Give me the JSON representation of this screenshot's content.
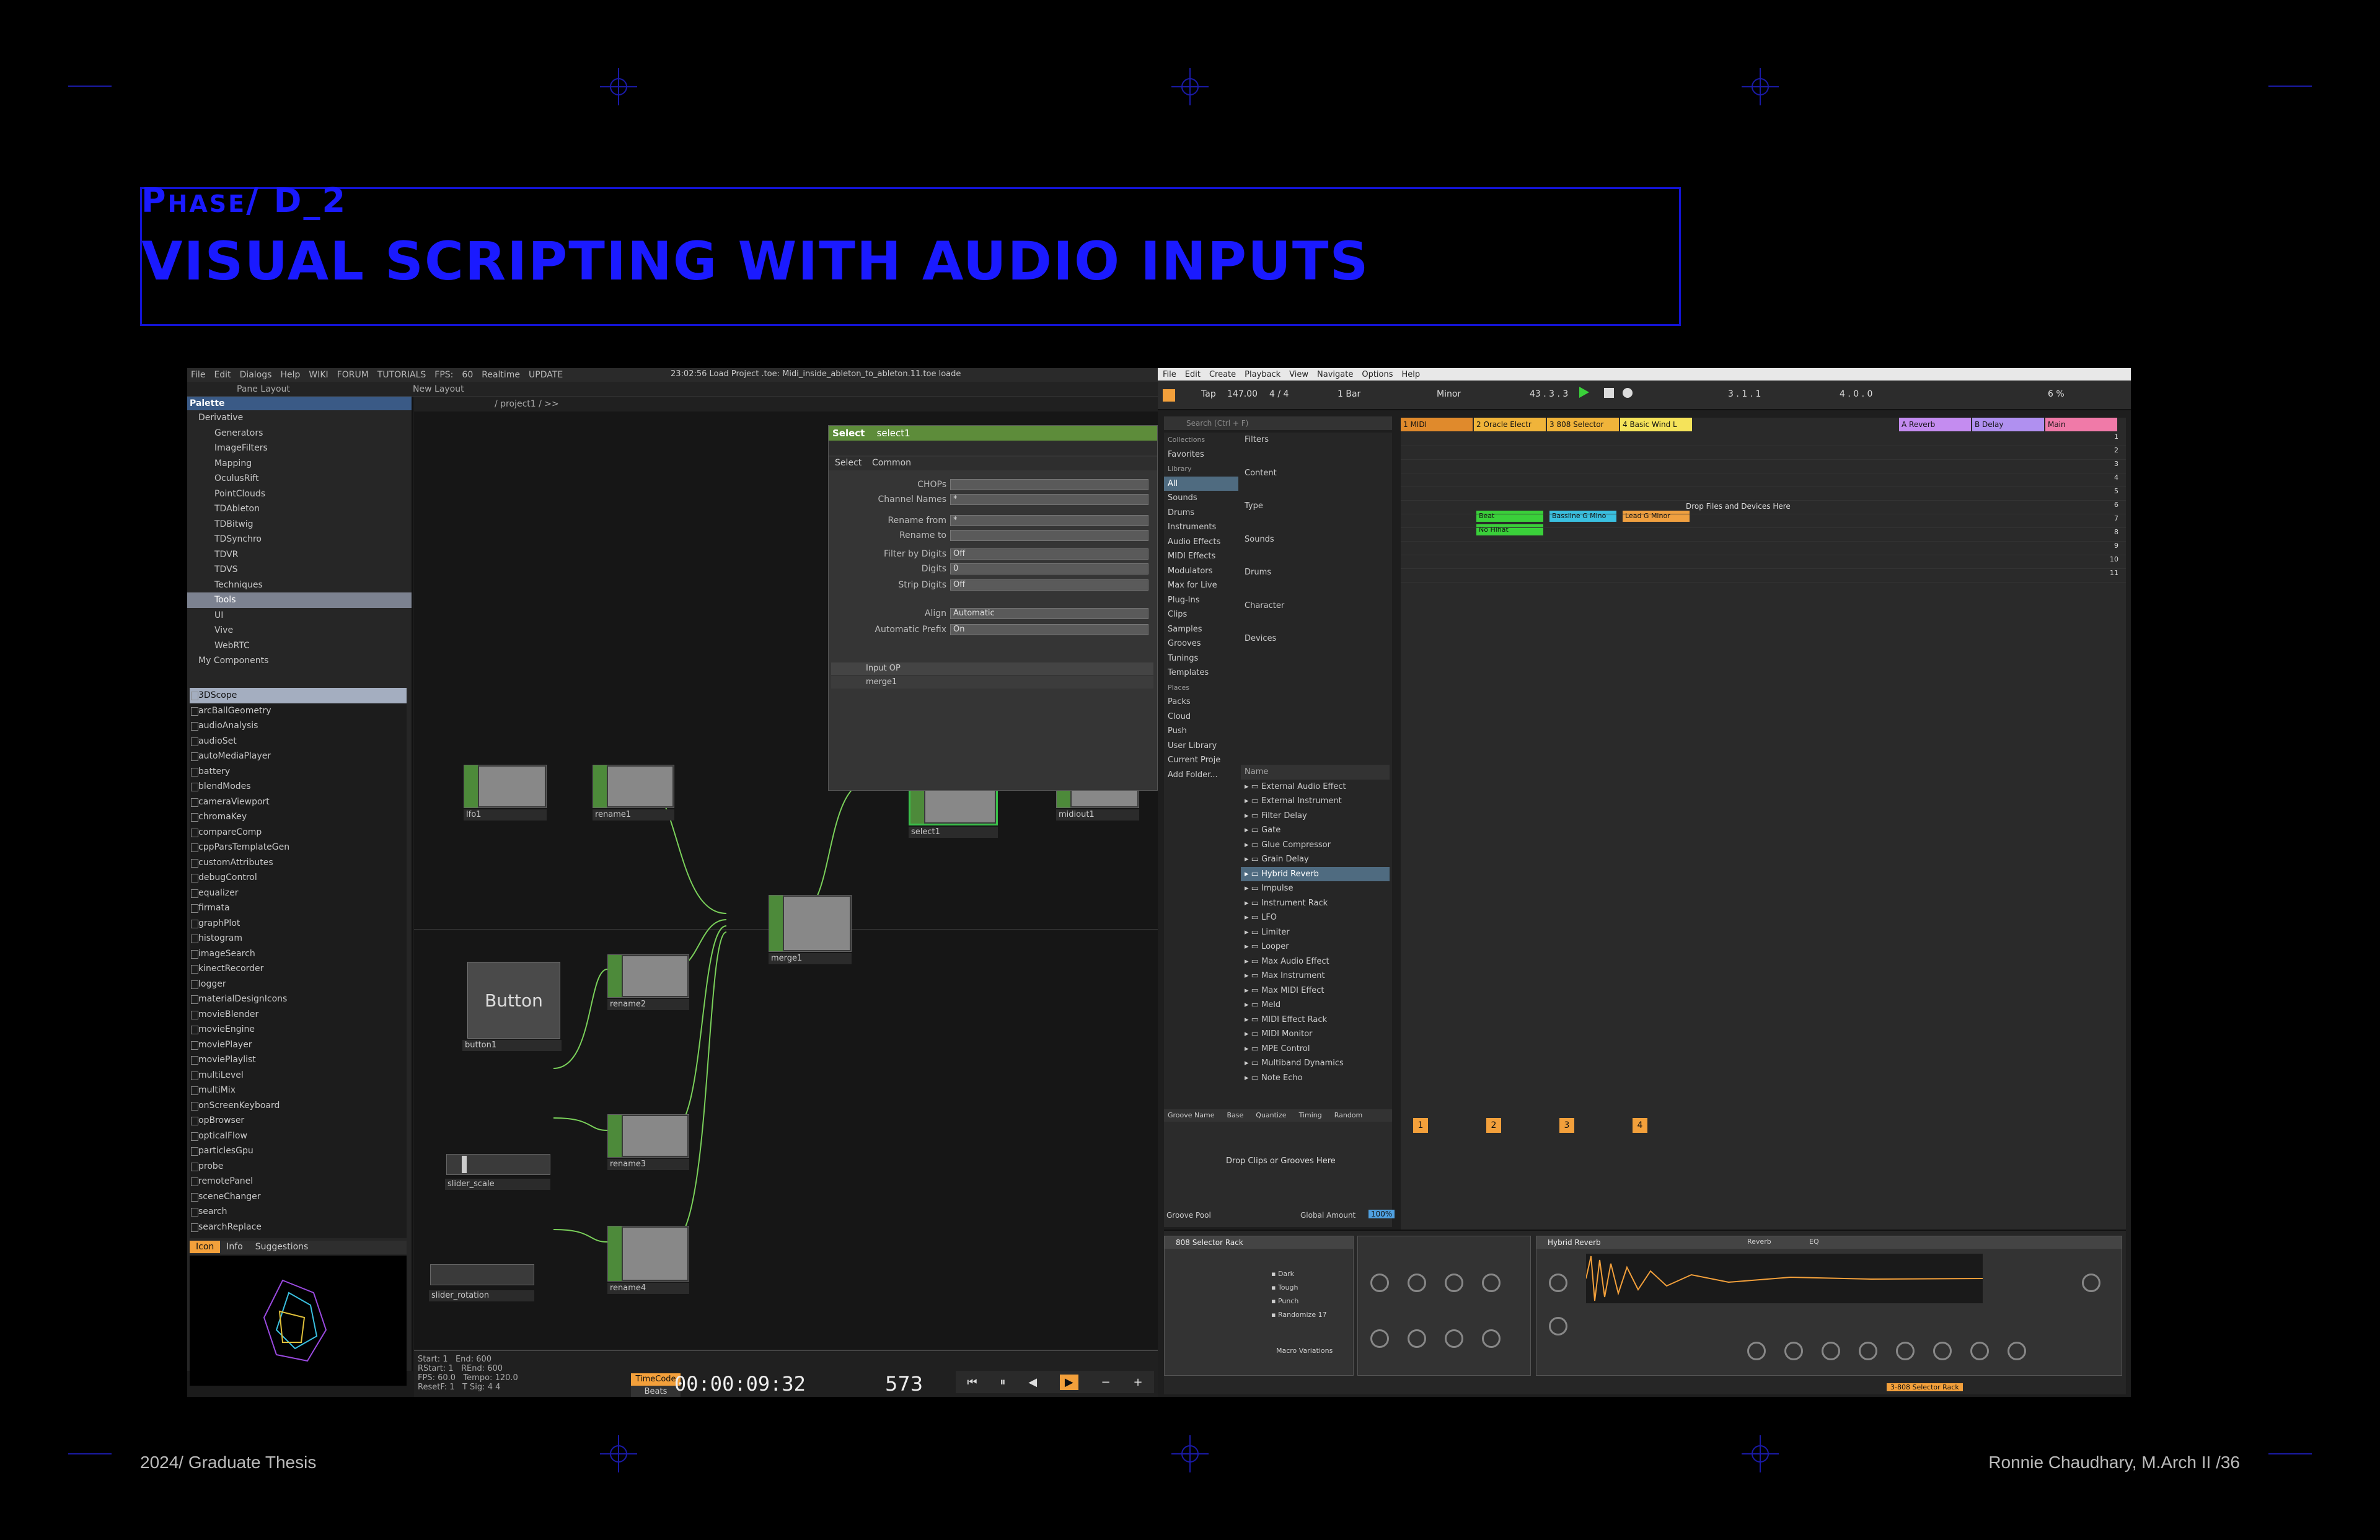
{
  "slide": {
    "phase": "Phase/ D_2",
    "title": "VISUAL SCRIPTING WITH AUDIO INPUTS",
    "footer_left": "2024/ Graduate Thesis",
    "footer_right": "Ronnie Chaudhary, M.Arch II /36",
    "accent_color": "#1a1aff"
  },
  "touchdesigner": {
    "menu": [
      "File",
      "Edit",
      "Dialogs",
      "Help",
      "WIKI",
      "FORUM",
      "TUTORIALS",
      "FPS:",
      "Realtime",
      "UPDATE"
    ],
    "fps_value": "60",
    "status_text": "23:02:56 Load Project .toe: Midi_inside_ableton_to_ableton.11.toe loade",
    "pane_layout": "Pane Layout",
    "new_layout": "New Layout",
    "path": "/ project1 / >>",
    "palette_title": "Palette",
    "tree": [
      "Derivative",
      "Generators",
      "ImageFilters",
      "Mapping",
      "OculusRift",
      "PointClouds",
      "TDAbleton",
      "TDBitwig",
      "TDSynchro",
      "TDVR",
      "TDVS",
      "Techniques",
      "Tools",
      "UI",
      "Vive",
      "WebRTC",
      "My Components"
    ],
    "oplist": [
      "3DScope",
      "arcBallGeometry",
      "audioAnalysis",
      "audioSet",
      "autoMediaPlayer",
      "battery",
      "blendModes",
      "cameraViewport",
      "chromaKey",
      "compareComp",
      "cppParsTemplateGen",
      "customAttributes",
      "debugControl",
      "equalizer",
      "firmata",
      "graphPlot",
      "histogram",
      "imageSearch",
      "kinectRecorder",
      "logger",
      "materialDesignIcons",
      "movieBlender",
      "movieEngine",
      "moviePlayer",
      "moviePlaylist",
      "multiLevel",
      "multiMix",
      "onScreenKeyboard",
      "opBrowser",
      "opticalFlow",
      "particlesGpu",
      "probe",
      "remotePanel",
      "sceneChanger",
      "search",
      "searchReplace"
    ],
    "palette_tabs": [
      "Icon",
      "Info",
      "Suggestions"
    ],
    "nodes": [
      "lfo1",
      "rename1",
      "merge1",
      "select1",
      "midiout1",
      "button1",
      "rename2",
      "slider_scale",
      "rename3",
      "slider_rotation",
      "rename4"
    ],
    "button_label": "Button",
    "param": {
      "type": "Select",
      "name": "select1",
      "tabs": [
        "Select",
        "Common"
      ],
      "rows": [
        {
          "label": "CHOPs",
          "value": ""
        },
        {
          "label": "Channel Names",
          "value": "*"
        },
        {
          "label": "Rename from",
          "value": "*"
        },
        {
          "label": "Rename to",
          "value": ""
        },
        {
          "label": "Filter by Digits",
          "value": "Off"
        },
        {
          "label": "Digits",
          "value": "0"
        },
        {
          "label": "Strip Digits",
          "value": "Off"
        },
        {
          "label": "Align",
          "value": "Automatic"
        },
        {
          "label": "Automatic Prefix",
          "value": "On"
        }
      ],
      "input_op_header": "Input OP",
      "input_op_value": "merge1"
    },
    "time": {
      "start": "1",
      "end": "600",
      "rstart": "1",
      "rend": "600",
      "fps": "60.0",
      "tempo": "120.0",
      "resetf": "1",
      "tsig": "4   4",
      "timecode_label": "TimeCode",
      "beats_label": "Beats",
      "timecode": "00:00:09:32",
      "frame": "573"
    }
  },
  "ableton": {
    "menu": [
      "File",
      "Edit",
      "Create",
      "Playback",
      "View",
      "Navigate",
      "Options",
      "Help"
    ],
    "tempo": "147.00",
    "signature": "4 / 4",
    "bar": "1 Bar",
    "scale": "Minor",
    "position": "43 . 3 . 3",
    "loop_start": "3 . 1 . 1",
    "loop_len": "4 . 0 . 0",
    "cpu": "6 %",
    "search_placeholder": "Search (Ctrl + F)",
    "browser": [
      "Collections",
      "Favorites",
      "Library",
      "All",
      "Sounds",
      "Drums",
      "Instruments",
      "Audio Effects",
      "MIDI Effects",
      "Modulators",
      "Max for Live",
      "Plug-Ins",
      "Clips",
      "Samples",
      "Grooves",
      "Tunings",
      "Templates",
      "Places",
      "Packs",
      "Cloud",
      "Push",
      "User Library",
      "Current Proje",
      "Add Folder..."
    ],
    "filters": [
      "Filters",
      "Content",
      "Type",
      "Sounds",
      "Drums",
      "Character",
      "Devices"
    ],
    "results": [
      "External Audio Effect",
      "External Instrument",
      "Filter Delay",
      "Gate",
      "Glue Compressor",
      "Grain Delay",
      "Hybrid Reverb",
      "Impulse",
      "Instrument Rack",
      "LFO",
      "Limiter",
      "Looper",
      "Max Audio Effect",
      "Max Instrument",
      "Max MIDI Effect",
      "Meld",
      "MIDI Effect Rack",
      "MIDI Monitor",
      "MPE Control",
      "Multiband Dynamics",
      "Note Echo"
    ],
    "results_header": "Name",
    "tracks": [
      {
        "name": "1 MIDI",
        "color": "#e08a2c"
      },
      {
        "name": "2 Oracle Electr",
        "color": "#f0b43a"
      },
      {
        "name": "3 808 Selector",
        "color": "#f0b43a"
      },
      {
        "name": "4 Basic Wind L",
        "color": "#f5e35a"
      }
    ],
    "returns": [
      {
        "name": "A Reverb",
        "color": "#c48cf0"
      },
      {
        "name": "B Delay",
        "color": "#b090f0"
      },
      {
        "name": "Main",
        "color": "#f07aa8"
      }
    ],
    "clips": [
      {
        "label": "Beat",
        "color": "#3ad03a"
      },
      {
        "label": "No Hihat",
        "color": "#3ad03a"
      },
      {
        "label": "Bassline G Mino",
        "color": "#3ac0e0"
      },
      {
        "label": "Lead G Minor",
        "color": "#f0a040"
      }
    ],
    "scenes": [
      "1",
      "2",
      "3",
      "4",
      "5",
      "6",
      "7",
      "8",
      "9",
      "10",
      "11"
    ],
    "drop_files": "Drop Files and Devices Here",
    "drop_clips": "Drop Clips or Grooves Here",
    "groove_cols": [
      "Groove Name",
      "Base",
      "Quantize",
      "Timing",
      "Random"
    ],
    "groove_pool": "Groove Pool",
    "global_amount": "Global Amount",
    "global_amount_value": "100%",
    "track_numbers": [
      "1",
      "2",
      "3",
      "4"
    ],
    "device_rack": "808 Selector Rack",
    "device_reverb": "Hybrid Reverb",
    "macro_variations": "Macro Variations",
    "rack_presets": [
      "Dark",
      "Tough",
      "Punch",
      "Randomize 17"
    ],
    "reverb_tabs": [
      "Reverb",
      "EQ"
    ],
    "bottom_label": "3-808 Selector Rack"
  }
}
